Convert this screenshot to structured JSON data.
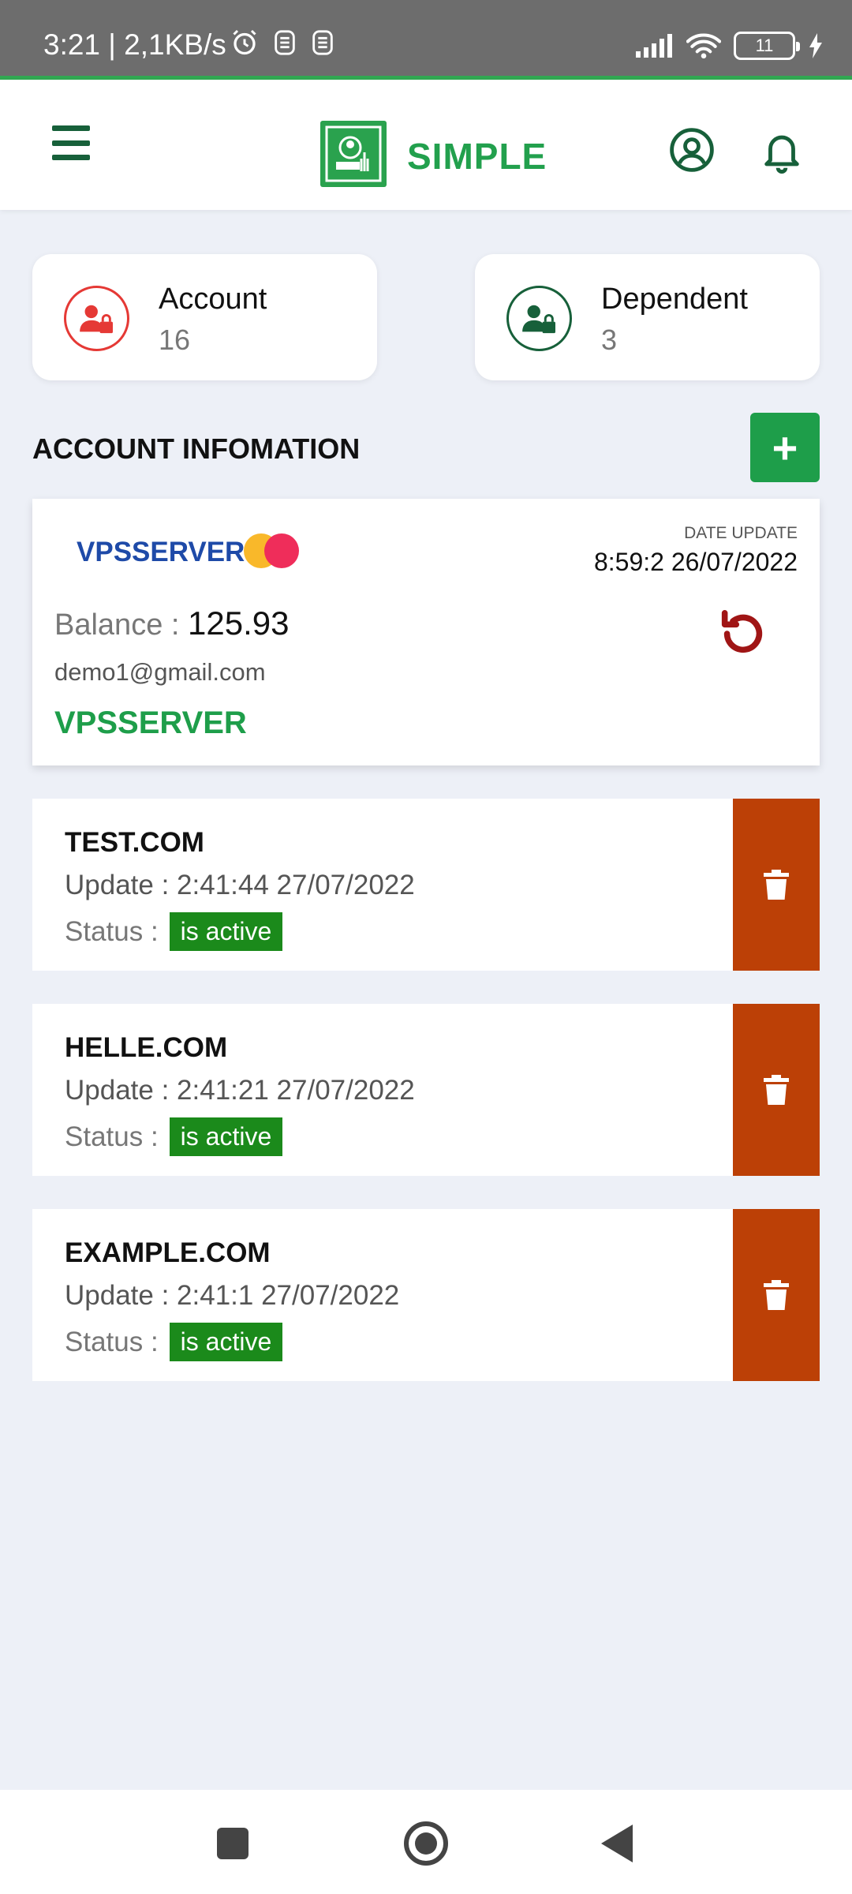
{
  "status_bar": {
    "time": "3:21 | 2,1KB/s",
    "battery": "11"
  },
  "app_bar": {
    "title": "SIMPLE"
  },
  "stats": [
    {
      "label": "Account",
      "value": "16",
      "color": "#e53935"
    },
    {
      "label": "Dependent",
      "value": "3",
      "color": "#17603a"
    }
  ],
  "section": {
    "title": "ACCOUNT INFOMATION",
    "add_label": "+"
  },
  "account": {
    "name": "VPSSERVER",
    "date_label": "DATE UPDATE",
    "date_value": "8:59:2 26/07/2022",
    "balance_label": "Balance :",
    "balance_value": "125.93",
    "email": "demo1@gmail.com",
    "provider": "VPSSERVER"
  },
  "domains": [
    {
      "name": "TEST.COM",
      "update_label": "Update :",
      "update_value": "2:41:44 27/07/2022",
      "status_label": "Status :",
      "status_value": "is active"
    },
    {
      "name": "HELLE.COM",
      "update_label": "Update :",
      "update_value": "2:41:21 27/07/2022",
      "status_label": "Status :",
      "status_value": "is active"
    },
    {
      "name": "EXAMPLE.COM",
      "update_label": "Update :",
      "update_value": "2:41:1 27/07/2022",
      "status_label": "Status :",
      "status_value": "is active"
    }
  ],
  "colors": {
    "brand_green": "#22a04d",
    "delete_orange": "#bc4006",
    "active_badge": "#1b8a1b",
    "account_blue": "#1e4aa8"
  }
}
